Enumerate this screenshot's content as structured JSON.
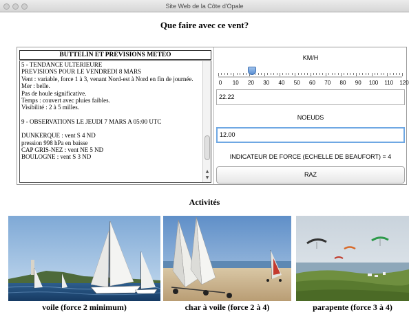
{
  "window": {
    "title": "Site Web de la Côte d'Opale"
  },
  "page": {
    "title": "Que faire avec ce vent?"
  },
  "bulletin": {
    "header": "BUTTELIN ET PREVISIONS METEO",
    "lines": [
      "5 - TENDANCE ULTERIEURE",
      "PREVISIONS POUR LE VENDREDI 8 MARS",
      "Vent : variable, force 1 à 3, venant Nord-est à Nord en fin de journée.",
      "Mer : belle.",
      "Pas de houle significative.",
      "Temps : couvert avec pluies faibles.",
      "Visibilité : 2 à 5 milles.",
      "",
      "9 - OBSERVATIONS LE JEUDI 7 MARS A 05:00 UTC",
      "",
      "DUNKERQUE : vent S 4 ND",
      "pression 998 hPa en baisse",
      "CAP GRIS-NEZ : vent NE 5 ND",
      "BOULOGNE : vent S 3 ND"
    ]
  },
  "converter": {
    "kmh_label": "KM/H",
    "slider": {
      "min": 0,
      "max": 120,
      "value": 22.22,
      "scale": [
        "0",
        "10",
        "20",
        "30",
        "40",
        "50",
        "60",
        "70",
        "80",
        "90",
        "100",
        "110",
        "120"
      ]
    },
    "kmh_value": "22.22",
    "noeuds_label": "NOEUDS",
    "noeuds_value": "12.00",
    "beaufort_text": "INDICATEUR DE FORCE (ECHELLE DE BEAUFORT) = 4",
    "raz_label": "RAZ"
  },
  "activities": {
    "title": "Activités",
    "items": [
      {
        "caption": "voile (force 2 minimum)",
        "icon": "sailboat-photo"
      },
      {
        "caption": "char à voile (force 2 à 4)",
        "icon": "land-yacht-photo"
      },
      {
        "caption": "parapente (force 3 à 4)",
        "icon": "paraglider-photo"
      }
    ]
  }
}
